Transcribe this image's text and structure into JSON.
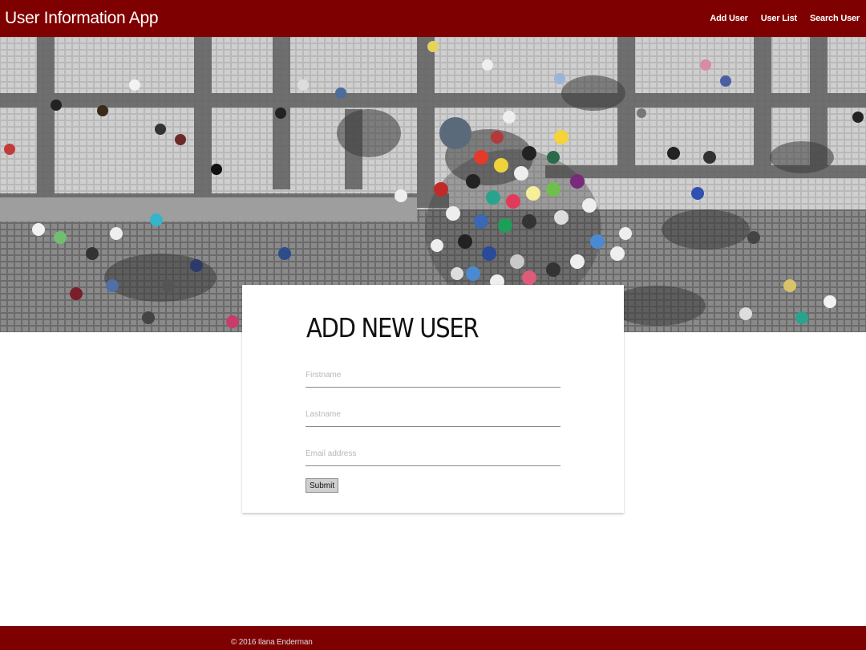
{
  "navbar": {
    "brand": "User Information App",
    "links": [
      "Add User",
      "User List",
      "Search User"
    ]
  },
  "hero": {
    "description_icon": "crowd-photo"
  },
  "form": {
    "title": "ADD NEW USER",
    "firstname_placeholder": "Firstname",
    "lastname_placeholder": "Lastname",
    "email_placeholder": "Email address",
    "submit_label": "Submit"
  },
  "footer": {
    "copyright": "© 2016 Ilana Enderman"
  },
  "colors": {
    "brand": "#7f0000",
    "background": "#ffffff"
  }
}
